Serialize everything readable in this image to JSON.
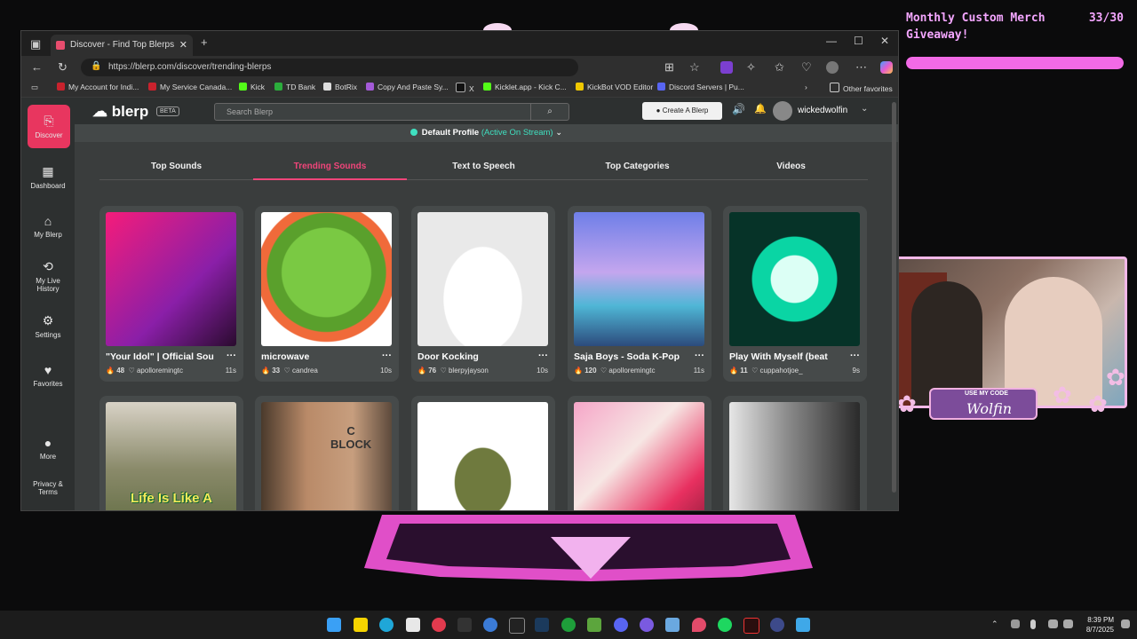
{
  "overlay": {
    "giveaway_line1": "Monthly Custom Merch",
    "giveaway_line2": "Giveaway!",
    "giveaway_count": "33/30",
    "giveaway_progress": 1.0,
    "code_label": "USE MY CODE",
    "code_value": "Wolfin"
  },
  "browser": {
    "tab_title": "Discover - Find Top Blerps, Stream",
    "url": "https://blerp.com/discover/trending-blerps",
    "bookmarks": [
      {
        "label": "My Account for Indi..."
      },
      {
        "label": "My Service Canada..."
      },
      {
        "label": "Kick"
      },
      {
        "label": "TD Bank"
      },
      {
        "label": "BotRix"
      },
      {
        "label": "Copy And Paste Sy..."
      },
      {
        "label": "X"
      },
      {
        "label": "Kicklet.app - Kick C..."
      },
      {
        "label": "KickBot VOD Editor"
      },
      {
        "label": "Discord Servers | Pu..."
      }
    ],
    "other_favorites": "Other favorites"
  },
  "sidebar": {
    "items": [
      {
        "label": "Discover"
      },
      {
        "label": "Dashboard"
      },
      {
        "label": "My Blerp"
      },
      {
        "label": "My Live History"
      },
      {
        "label": "Settings"
      },
      {
        "label": "Favorites"
      },
      {
        "label": "More"
      },
      {
        "label": "Privacy & Terms"
      }
    ]
  },
  "header": {
    "logo": "blerp",
    "beta": "BETA",
    "search_placeholder": "Search Blerp",
    "create_button": "Create A Blerp",
    "username": "wickedwolfin"
  },
  "profile": {
    "name": "Default Profile",
    "status": "(Active On Stream)"
  },
  "tabs": [
    "Top Sounds",
    "Trending Sounds",
    "Text to Speech",
    "Top Categories",
    "Videos"
  ],
  "cards": [
    {
      "title": "\"Your Idol\" | Official Sou",
      "count": "48",
      "user": "apolloremingtc",
      "duration": "11s"
    },
    {
      "title": "microwave",
      "count": "33",
      "user": "candrea",
      "duration": "10s"
    },
    {
      "title": "Door Kocking",
      "count": "76",
      "user": "blerpyjayson",
      "duration": "10s"
    },
    {
      "title": "Saja Boys - Soda K-Pop",
      "count": "120",
      "user": "apolloremingtc",
      "duration": "11s"
    },
    {
      "title": "Play With Myself (beat",
      "count": "11",
      "user": "cuppahotjoe_",
      "duration": "9s"
    }
  ],
  "row2_caption": "Life Is Like A",
  "row2_block": "C\nBLOCK",
  "taskbar": {
    "time": "8:39 PM",
    "date": "8/7/2025"
  }
}
